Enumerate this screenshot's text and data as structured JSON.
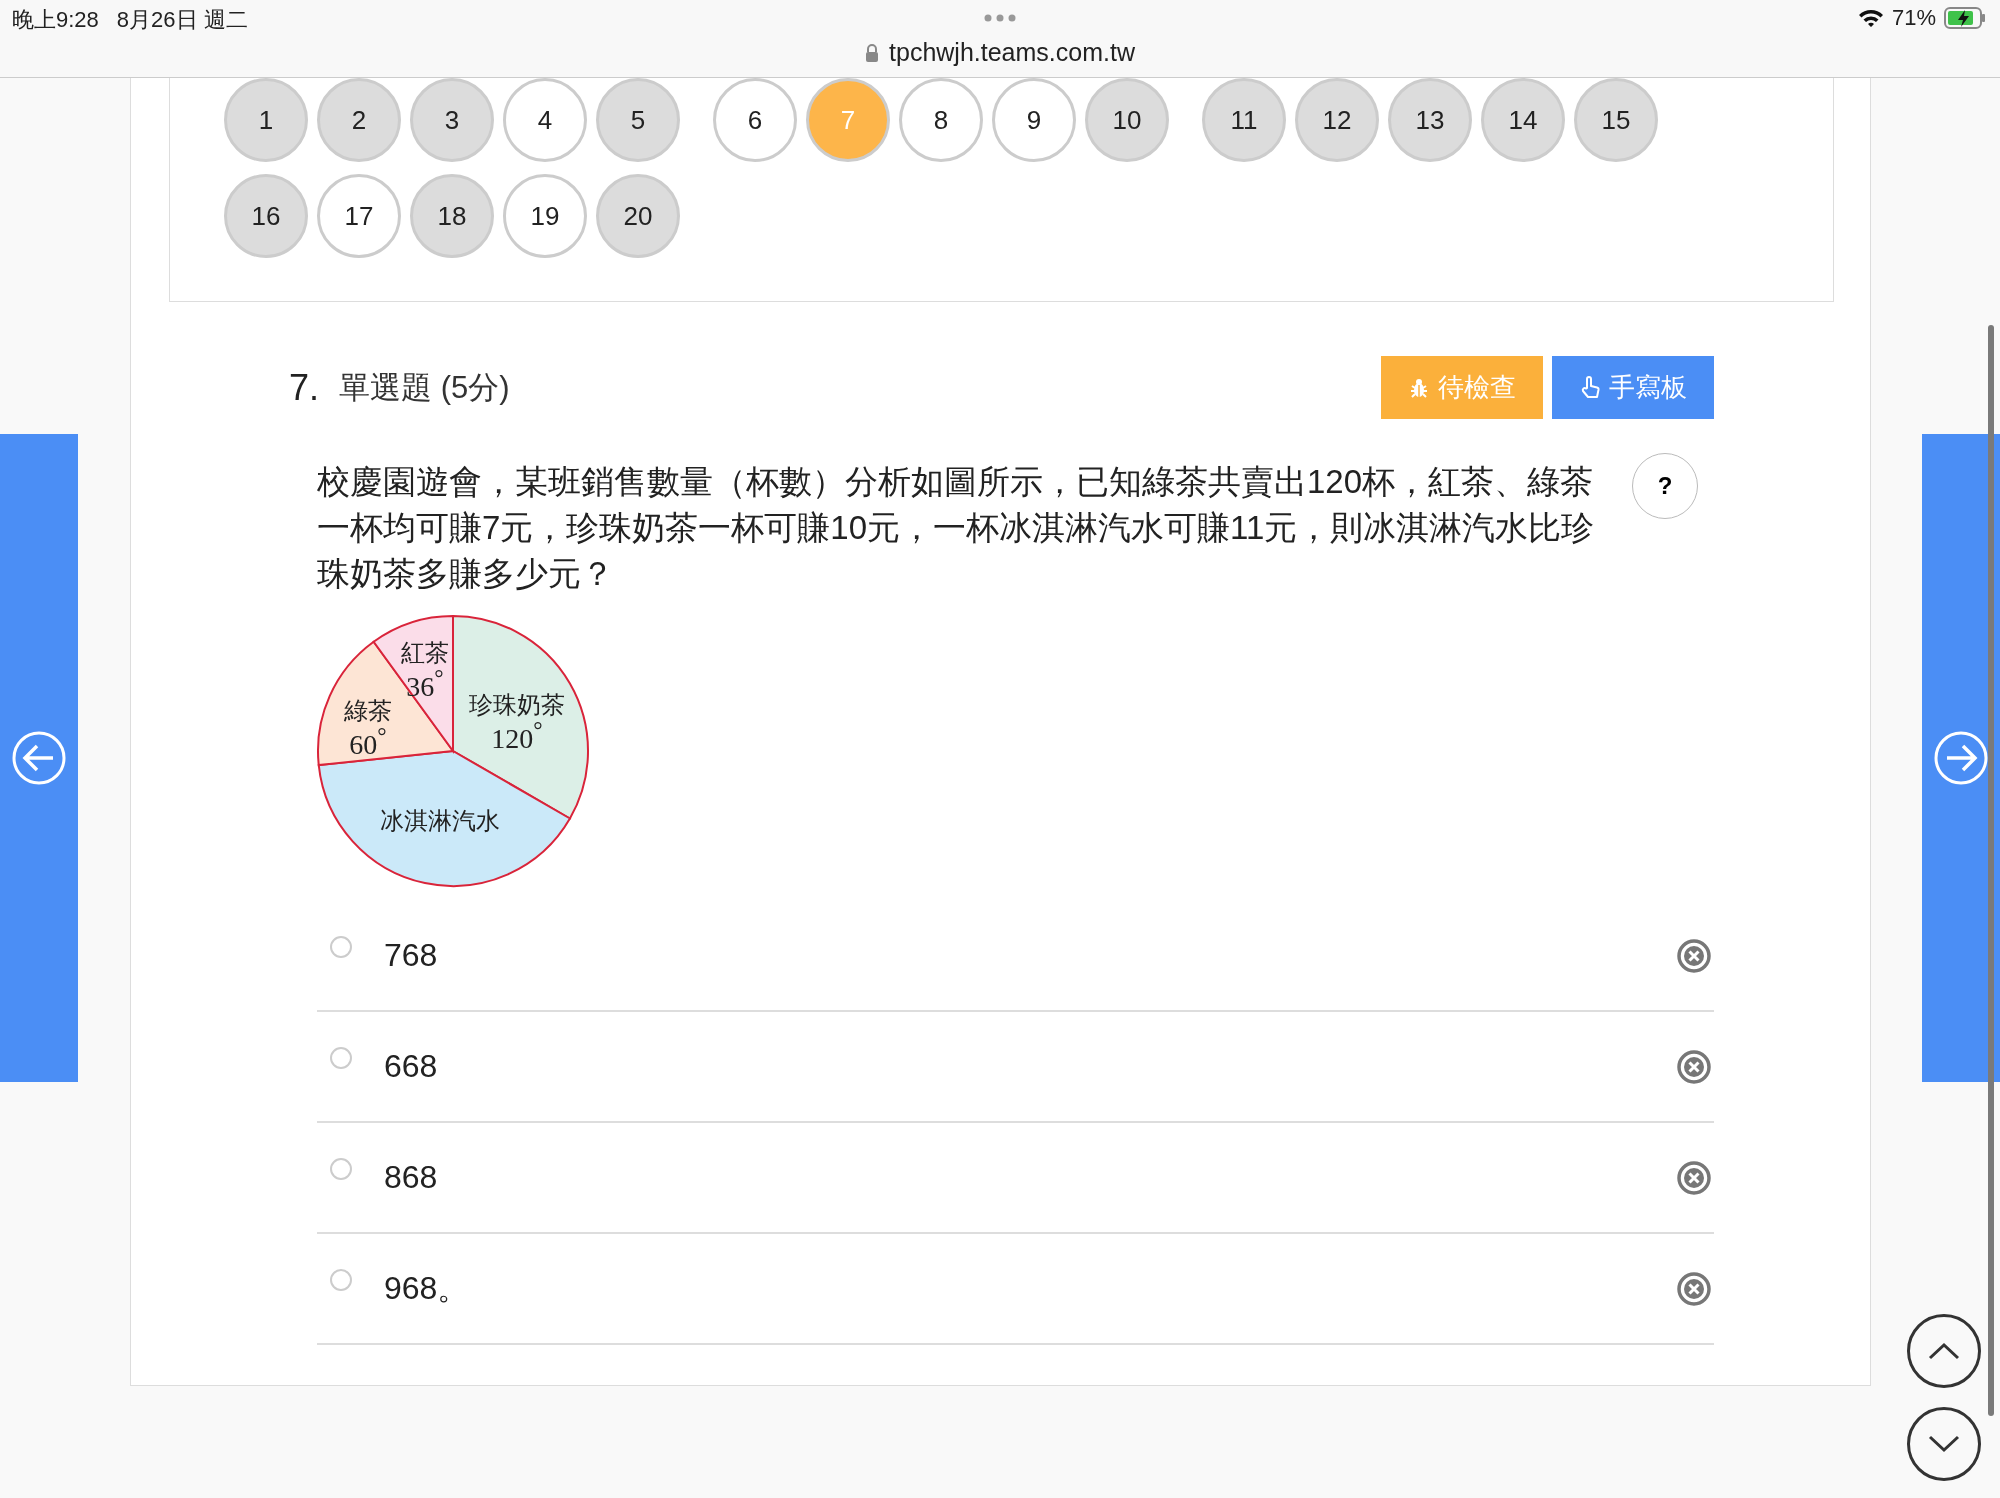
{
  "status_bar": {
    "time": "晚上9:28",
    "date": "8月26日 週二",
    "url": "tpchwjh.teams.com.tw",
    "battery": "71%"
  },
  "question_nav": [
    {
      "label": "1",
      "answered": true,
      "selected": false
    },
    {
      "label": "2",
      "answered": true,
      "selected": false
    },
    {
      "label": "3",
      "answered": true,
      "selected": false
    },
    {
      "label": "4",
      "answered": false,
      "selected": false
    },
    {
      "label": "5",
      "answered": true,
      "selected": false
    },
    {
      "label": "6",
      "answered": false,
      "selected": false
    },
    {
      "label": "7",
      "selected": true
    },
    {
      "label": "8",
      "answered": false,
      "selected": false
    },
    {
      "label": "9",
      "answered": false,
      "selected": false
    },
    {
      "label": "10",
      "answered": true,
      "selected": false
    },
    {
      "label": "11",
      "answered": true,
      "selected": false
    },
    {
      "label": "12",
      "answered": true,
      "selected": false
    },
    {
      "label": "13",
      "answered": true,
      "selected": false
    },
    {
      "label": "14",
      "answered": true,
      "selected": false
    },
    {
      "label": "15",
      "answered": true,
      "selected": false
    },
    {
      "label": "16",
      "answered": true,
      "selected": false
    },
    {
      "label": "17",
      "answered": false,
      "selected": false
    },
    {
      "label": "18",
      "answered": true,
      "selected": false
    },
    {
      "label": "19",
      "answered": false,
      "selected": false
    },
    {
      "label": "20",
      "answered": true,
      "selected": false
    }
  ],
  "question": {
    "number": "7.",
    "type": "單選題 (5分)",
    "buttons": [
      {
        "label": "待檢查",
        "kind": "review"
      },
      {
        "label": "手寫板",
        "kind": "handwriting"
      }
    ],
    "help": "?",
    "text": "校慶園遊會，某班銷售數量（杯數）分析如圖所示，已知綠茶共賣出120杯，紅茶、綠茶一杯均可賺7元，珍珠奶茶一杯可賺10元，一杯冰淇淋汽水可賺11元，則冰淇淋汽水比珍珠奶茶多賺多少元？",
    "figure": {
      "slices": [
        {
          "name": "珍珠奶茶",
          "angle": "120$^{°}$",
          "color": "#dcefe7"
        },
        {
          "name": "冰淇淋汽水",
          "color": "#cbe9f9"
        },
        {
          "name": "綠茶",
          "angle": "60$^{°}$",
          "color": "#fde5d5"
        },
        {
          "name": "紅茶",
          "angle": "36$^{°}$",
          "color": "#fbdde9"
        }
      ]
    }
  },
  "options": [
    {
      "label": "768",
      "selected": false
    },
    {
      "label": "668",
      "selected": false
    },
    {
      "label": "868",
      "selected": false
    },
    {
      "label": "968。",
      "selected": false
    }
  ]
}
